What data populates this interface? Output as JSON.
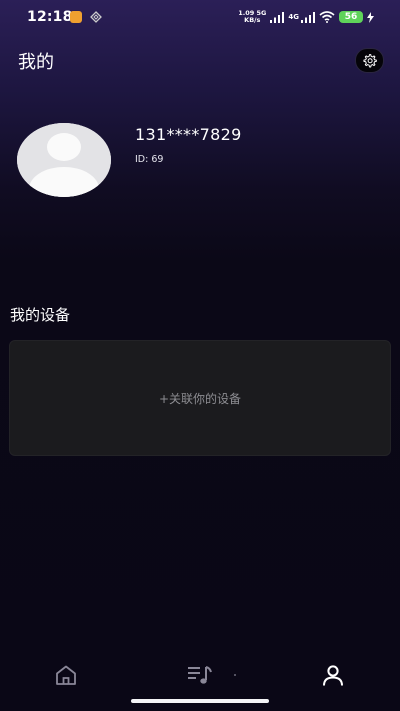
{
  "status_bar": {
    "time": "12:18",
    "network_speed_value": "1.09",
    "network_speed_unit": "KB/s",
    "network_5g": "5G",
    "network_4g": "4G",
    "battery": "56",
    "icons": [
      "app-notification-icon",
      "nfc-icon",
      "signal-icon",
      "signal-icon",
      "wifi-icon",
      "battery-icon",
      "charging-icon"
    ]
  },
  "header": {
    "title": "我的",
    "settings_icon": "gear-icon"
  },
  "profile": {
    "phone": "131****7829",
    "id_label": "ID: 69",
    "avatar_icon": "avatar-placeholder-icon"
  },
  "devices": {
    "section_title": "我的设备",
    "add_label": "+关联你的设备"
  },
  "tabbar": {
    "tabs": [
      {
        "icon": "home-icon",
        "active": false
      },
      {
        "icon": "music-list-icon",
        "active": false
      },
      {
        "icon": "person-icon",
        "active": true
      }
    ]
  },
  "colors": {
    "background_top": "#2b1f57",
    "background_bottom": "#0a0716",
    "card": "#1b1b1e",
    "battery": "#5fd35a"
  }
}
